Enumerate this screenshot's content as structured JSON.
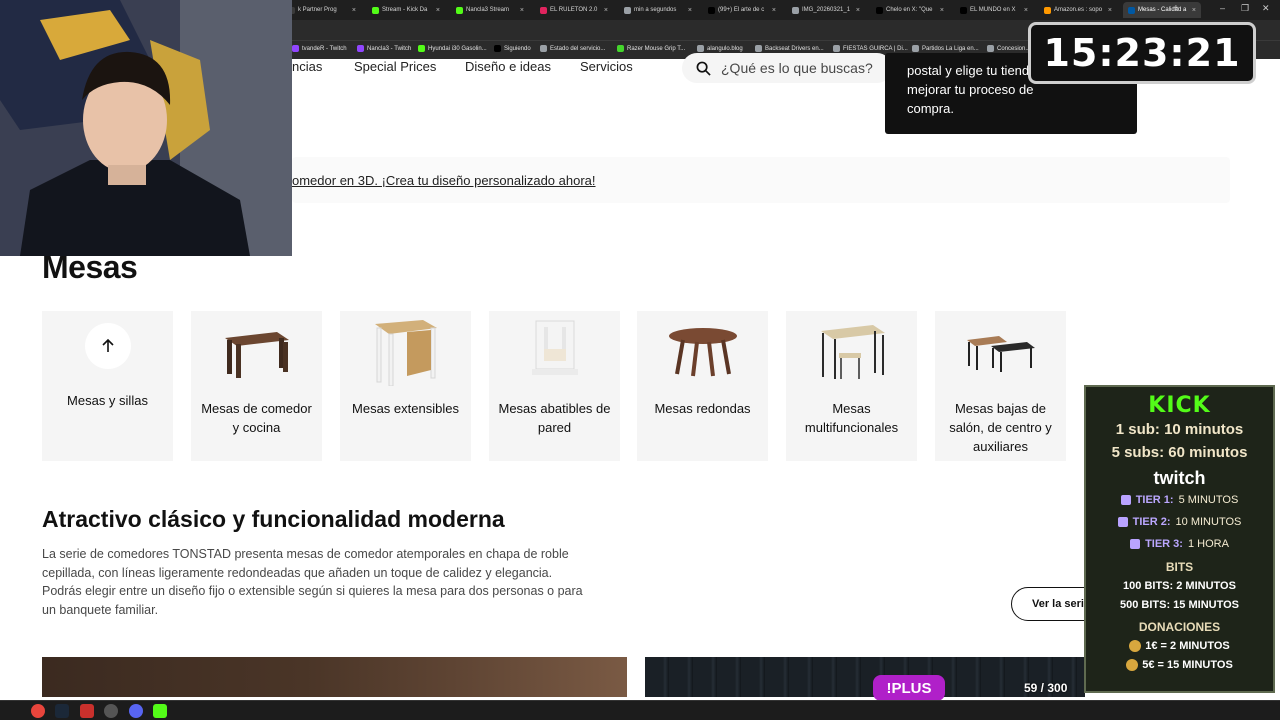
{
  "browser": {
    "tabs": [
      {
        "label": "k Partner Prog",
        "color": "#3a3a3a"
      },
      {
        "label": "Stream - Kick Da",
        "color": "#53fc18"
      },
      {
        "label": "Nancla3 Stream",
        "color": "#53fc18"
      },
      {
        "label": "EL RULETON 2.0",
        "color": "#e0245e"
      },
      {
        "label": "min a segundos",
        "color": "#9aa0a6"
      },
      {
        "label": "(99+) El arte de c",
        "color": "#000000"
      },
      {
        "label": "IMG_20260321_1",
        "color": "#9aa0a6"
      },
      {
        "label": "Chelo en X: \"Que",
        "color": "#000000"
      },
      {
        "label": "EL MUNDO en X",
        "color": "#000000"
      },
      {
        "label": "Amazon.es : sopo",
        "color": "#ff9900"
      },
      {
        "label": "Mesas - Calidad a",
        "color": "#0058a3"
      }
    ],
    "tab_close_symbol": "×",
    "new_tab_symbol": "+",
    "window_controls": [
      "–",
      "❐",
      "✕"
    ],
    "bookmarks": [
      {
        "label": "tvandeR - Twitch",
        "color": "#9146ff"
      },
      {
        "label": "Nancla3 - Twitch",
        "color": "#9146ff"
      },
      {
        "label": "Hyundai i30 Gasolin...",
        "color": "#53fc18"
      },
      {
        "label": "Siguiendo",
        "color": "#000000"
      },
      {
        "label": "Estado del servicio...",
        "color": "#9aa0a6"
      },
      {
        "label": "Razer Mouse Grip T...",
        "color": "#44d62c"
      },
      {
        "label": "alangulo.blog",
        "color": "#9aa0a6"
      },
      {
        "label": "Backseat Drivers en...",
        "color": "#9aa0a6"
      },
      {
        "label": "FIESTAS GUIRCA | Di...",
        "color": "#9aa0a6"
      },
      {
        "label": "Partidos La Liga en...",
        "color": "#9aa0a6"
      },
      {
        "label": "Concesion...",
        "color": "#9aa0a6"
      }
    ]
  },
  "nav": {
    "items": [
      "ncias",
      "Special Prices",
      "Diseño e ideas",
      "Servicios"
    ],
    "search_placeholder": "¿Qué es lo que buscas?"
  },
  "tooltip": {
    "lines": [
      "postal y elige tu tiend",
      "mejorar tu proceso de",
      "compra."
    ],
    "close": "×"
  },
  "promo": {
    "text": "omedor en 3D. ¡Crea tu diseño personalizado ahora!"
  },
  "page_title": "Mesas",
  "categories": [
    {
      "label": "Mesas y sillas",
      "icon": "arrow-up-icon"
    },
    {
      "label": "Mesas de comedor y cocina",
      "icon": "dining-table-icon"
    },
    {
      "label": "Mesas extensibles",
      "icon": "extendable-table-icon"
    },
    {
      "label": "Mesas abatibles de pared",
      "icon": "wall-table-icon"
    },
    {
      "label": "Mesas redondas",
      "icon": "round-table-icon"
    },
    {
      "label": "Mesas multifuncionales",
      "icon": "multi-table-icon"
    },
    {
      "label": "Mesas bajas de salón, de centro y auxiliares",
      "icon": "coffee-table-icon"
    }
  ],
  "section": {
    "title": "Atractivo clásico y funcionalidad moderna",
    "body": "La serie de comedores TONSTAD presenta mesas de comedor atemporales en chapa de roble cepillada, con líneas ligeramente redondeadas que añaden un toque de calidez y elegancia. Podrás elegir entre un diseño fijo o extensible según si quieres la mesa para dos personas o para un banquete familiar.",
    "button": "Ver la seri"
  },
  "overlay": {
    "clock": "15:23:21",
    "kick_logo": "KICK",
    "kick_lines": [
      "1 sub: 10 minutos",
      "5 subs: 60 minutos"
    ],
    "twitch_logo": "twitch",
    "tiers": [
      {
        "name": "TIER 1:",
        "value": "5 MINUTOS"
      },
      {
        "name": "TIER 2:",
        "value": "10 MINUTOS"
      },
      {
        "name": "TIER 3:",
        "value": "1 HORA"
      }
    ],
    "bits_header": "BITS",
    "bits_lines": [
      "100 BITS: 2 MINUTOS",
      "500 BITS: 15 MINUTOS"
    ],
    "donations_header": "DONACIONES",
    "donation_lines": [
      "1€ = 2 MINUTOS",
      "5€ = 15 MINUTOS"
    ],
    "plus_badge": "!PLUS",
    "counter": "59 / 300"
  }
}
